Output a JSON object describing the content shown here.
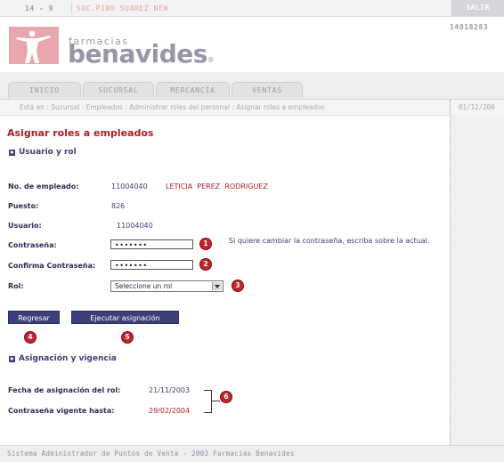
{
  "topbar": {
    "store_id": "14 - 9",
    "store_name": "SUC.PINO SUAREZ NEW",
    "exit_label": "SALIR"
  },
  "header": {
    "logo_small": "farmacias",
    "logo_main": "benavides",
    "logo_mark": "®",
    "terminal_id": "14018283"
  },
  "tabs": [
    {
      "label": "INICIO"
    },
    {
      "label": "SUCURSAL"
    },
    {
      "label": "MERCANCÍA"
    },
    {
      "label": "VENTAS"
    }
  ],
  "breadcrumb": "Está en : Sucursal : Empleados : Administrar roles del personal : Asignar roles a empleados",
  "date_top": "01/12/200",
  "page_title": "Asignar roles a empleados",
  "section_user": "Usuario y rol",
  "employee": {
    "number_label": "No. de empleado:",
    "number_value": "11004040",
    "name_value": "LETICIA  PEREZ  RODRIGUEZ",
    "position_label": "Puesto:",
    "position_value": "826",
    "user_label": "Usuario:",
    "user_value": "11004040"
  },
  "form": {
    "password_label": "Contraseña:",
    "password_value": "•••••••",
    "confirm_label": "Confirma Contraseña:",
    "confirm_value": "•••••••",
    "role_label": "Rol:",
    "role_value": "Seleccione un rol",
    "hint": "Si quiere cambiar la contraseña, escriba sobre la actual."
  },
  "buttons": {
    "back": "Regresar",
    "execute": "Ejecutar asignación"
  },
  "badges": [
    "1",
    "2",
    "3",
    "4",
    "5",
    "6"
  ],
  "section_validity": "Asignación y vigencia",
  "validity": {
    "assign_label": "Fecha de asignación del rol:",
    "assign_value": "21/11/2003",
    "valid_label": "Contraseña vigente hasta:",
    "valid_value": "29/02/2004"
  },
  "footer": "Sistema Administrador de Puntos de Venta - 2003 Farmacias Benavides",
  "colors": {
    "accent": "#3c3f79",
    "title_red": "#b01c23",
    "badge_red": "#c0262e",
    "logo_pink": "#e8a7ad"
  }
}
